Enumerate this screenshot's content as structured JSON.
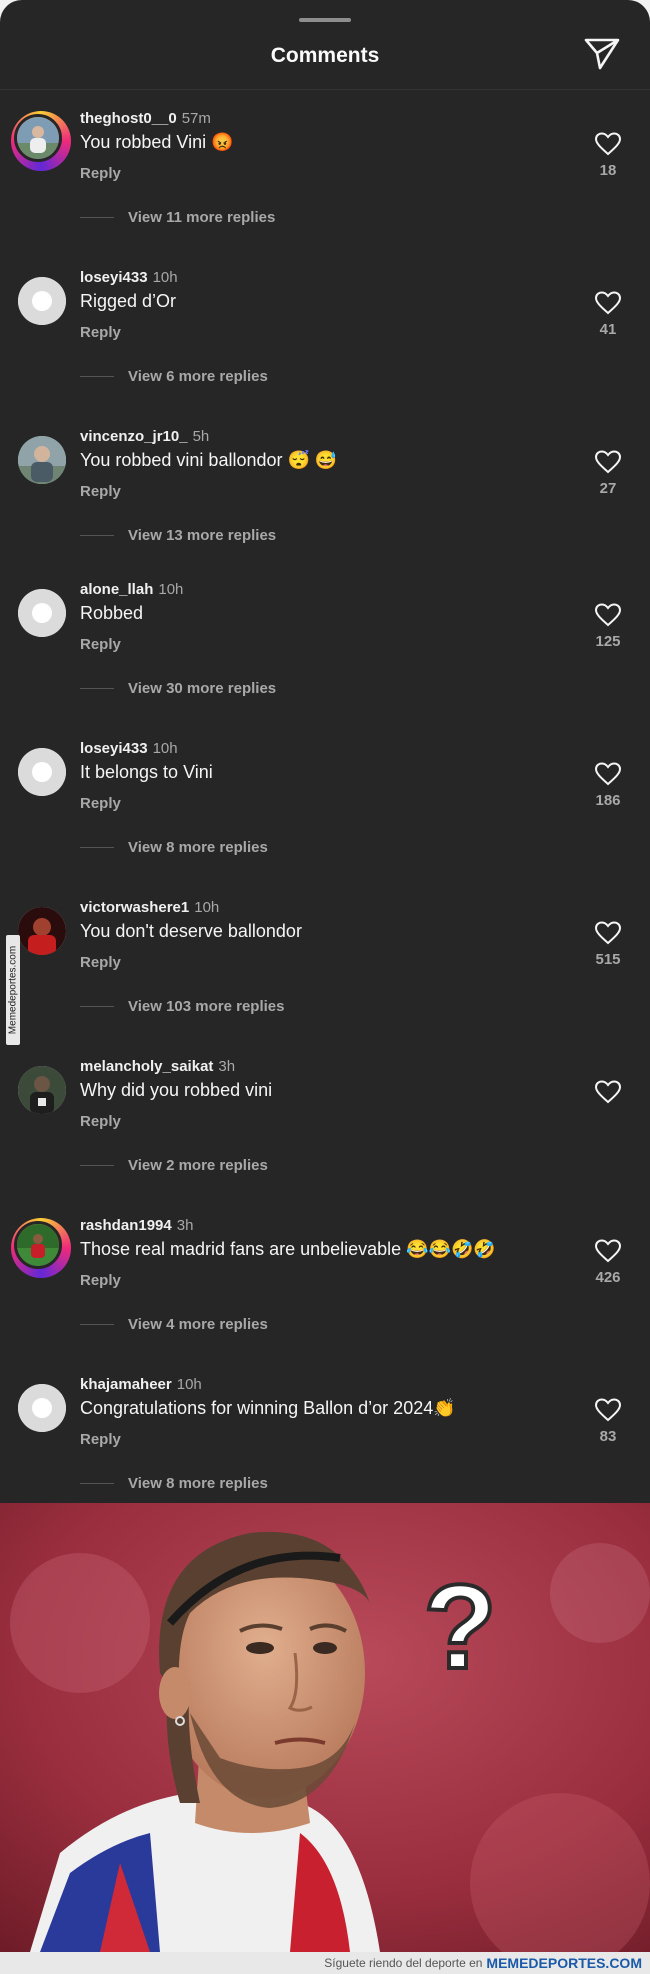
{
  "header": {
    "title": "Comments",
    "send_icon": "send-icon"
  },
  "comments": [
    {
      "username": "theghost0__0",
      "time": "57m",
      "text": "You robbed Vini 😡",
      "reply": "Reply",
      "likes": "18",
      "view_more": "View 11 more replies",
      "avatar": "photo-ring"
    },
    {
      "username": "loseyi433",
      "time": "10h",
      "text": "Rigged d’Or",
      "reply": "Reply",
      "likes": "41",
      "view_more": "View 6 more replies",
      "avatar": "default"
    },
    {
      "username": "vincenzo_jr10_",
      "time": "5h",
      "text": "You robbed vini ballondor 😴 😅",
      "reply": "Reply",
      "likes": "27",
      "view_more": "View 13 more replies",
      "avatar": "photo"
    },
    {
      "username": "alone_llah",
      "time": "10h",
      "text": "Robbed",
      "reply": "Reply",
      "likes": "125",
      "view_more": "View 30 more replies",
      "avatar": "default"
    },
    {
      "username": "loseyi433",
      "time": "10h",
      "text": "It belongs to Vini",
      "reply": "Reply",
      "likes": "186",
      "view_more": "View 8 more replies",
      "avatar": "default"
    },
    {
      "username": "victorwashere1",
      "time": "10h",
      "text": "You don't deserve ballondor",
      "reply": "Reply",
      "likes": "515",
      "view_more": "View 103 more replies",
      "avatar": "photo-red"
    },
    {
      "username": "melancholy_saikat",
      "time": "3h",
      "text": "Why did you robbed vini",
      "reply": "Reply",
      "likes": "",
      "view_more": "View 2 more replies",
      "avatar": "photo-dark"
    },
    {
      "username": "rashdan1994",
      "time": "3h",
      "text": "Those real madrid fans are unbelievable 😂😂🤣🤣",
      "reply": "Reply",
      "likes": "426",
      "view_more": "View 4 more replies",
      "avatar": "photo-ring-green"
    },
    {
      "username": "khajamaheer",
      "time": "10h",
      "text": "Congratulations for winning Ballon d’or 2024👏",
      "reply": "Reply",
      "likes": "83",
      "view_more": "View 8 more replies",
      "avatar": "default"
    }
  ],
  "meme": {
    "question_mark": "?",
    "description_icon": "confused-player-photo"
  },
  "watermark": {
    "side": "Memedeportes.com",
    "footer_text": "Síguete riendo del deporte en",
    "footer_brand": "MEMEDEPORTES.COM"
  },
  "colors": {
    "background": "#262626",
    "text": "#f5f5f5",
    "secondary": "#a8a8a8"
  }
}
